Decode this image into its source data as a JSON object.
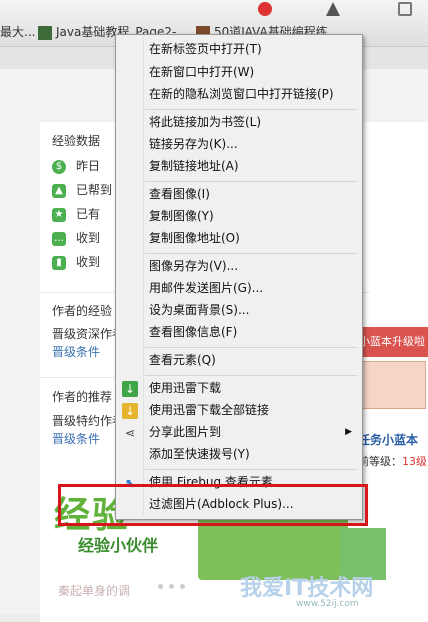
{
  "bookmarks_bar": {
    "items": [
      {
        "label": "最大..."
      },
      {
        "label": "Java基础教程_Page2-..."
      },
      {
        "label": "50道JAVA基础编程练..."
      }
    ]
  },
  "page": {
    "experience": {
      "title": "经验数据",
      "rows": [
        {
          "text": "昨日",
          "icon": "dollar-icon",
          "color": "#4caf50"
        },
        {
          "text": "已帮到",
          "icon": "thumbs-up-icon",
          "color": "#4caf50"
        },
        {
          "text": "已有",
          "icon": "star-icon",
          "color": "#4caf50"
        },
        {
          "text": "收到",
          "icon": "comment-icon",
          "color": "#4caf50"
        },
        {
          "text": "收到",
          "icon": "bar-chart-icon",
          "color": "#4caf50"
        }
      ]
    },
    "author_exp": {
      "title": "作者的经验",
      "line1": "晋级资深作者",
      "line2": "晋级条件"
    },
    "author_rec": {
      "title": "作者的推荐",
      "line1": "晋级特约作者",
      "line2": "晋级条件"
    },
    "right_ad": {
      "band": "小蓝本升级啦",
      "title": "任务小蓝本",
      "level_prefix": "前等级：",
      "level_value": "13级"
    },
    "banner": {
      "title": "经验",
      "subtitle": "经验小伙伴",
      "author": "秦起单身的调"
    },
    "watermark": {
      "text": "我爱IT技术网",
      "url": "www.52ij.com"
    }
  },
  "context_menu": {
    "items": [
      {
        "label": "在新标签页中打开(T)"
      },
      {
        "label": "在新窗口中打开(W)"
      },
      {
        "label": "在新的隐私浏览窗口中打开链接(P)"
      },
      {
        "label": "将此链接加为书签(L)"
      },
      {
        "label": "链接另存为(K)..."
      },
      {
        "label": "复制链接地址(A)"
      },
      {
        "label": "查看图像(I)"
      },
      {
        "label": "复制图像(Y)"
      },
      {
        "label": "复制图像地址(O)"
      },
      {
        "label": "图像另存为(V)..."
      },
      {
        "label": "用邮件发送图片(G)..."
      },
      {
        "label": "设为桌面背景(S)..."
      },
      {
        "label": "查看图像信息(F)"
      },
      {
        "label": "查看元素(Q)"
      },
      {
        "label": "使用迅雷下载"
      },
      {
        "label": "使用迅雷下载全部链接"
      },
      {
        "label": "分享此图片到"
      },
      {
        "label": "添加至快速拨号(Y)"
      },
      {
        "label": "使用 Firebug 查看元素"
      },
      {
        "label": "过滤图片(Adblock Plus)..."
      }
    ]
  },
  "colors": {
    "highlight": "#d8151b",
    "link": "#3a6fb0",
    "accent_green": "#5fb23a"
  }
}
